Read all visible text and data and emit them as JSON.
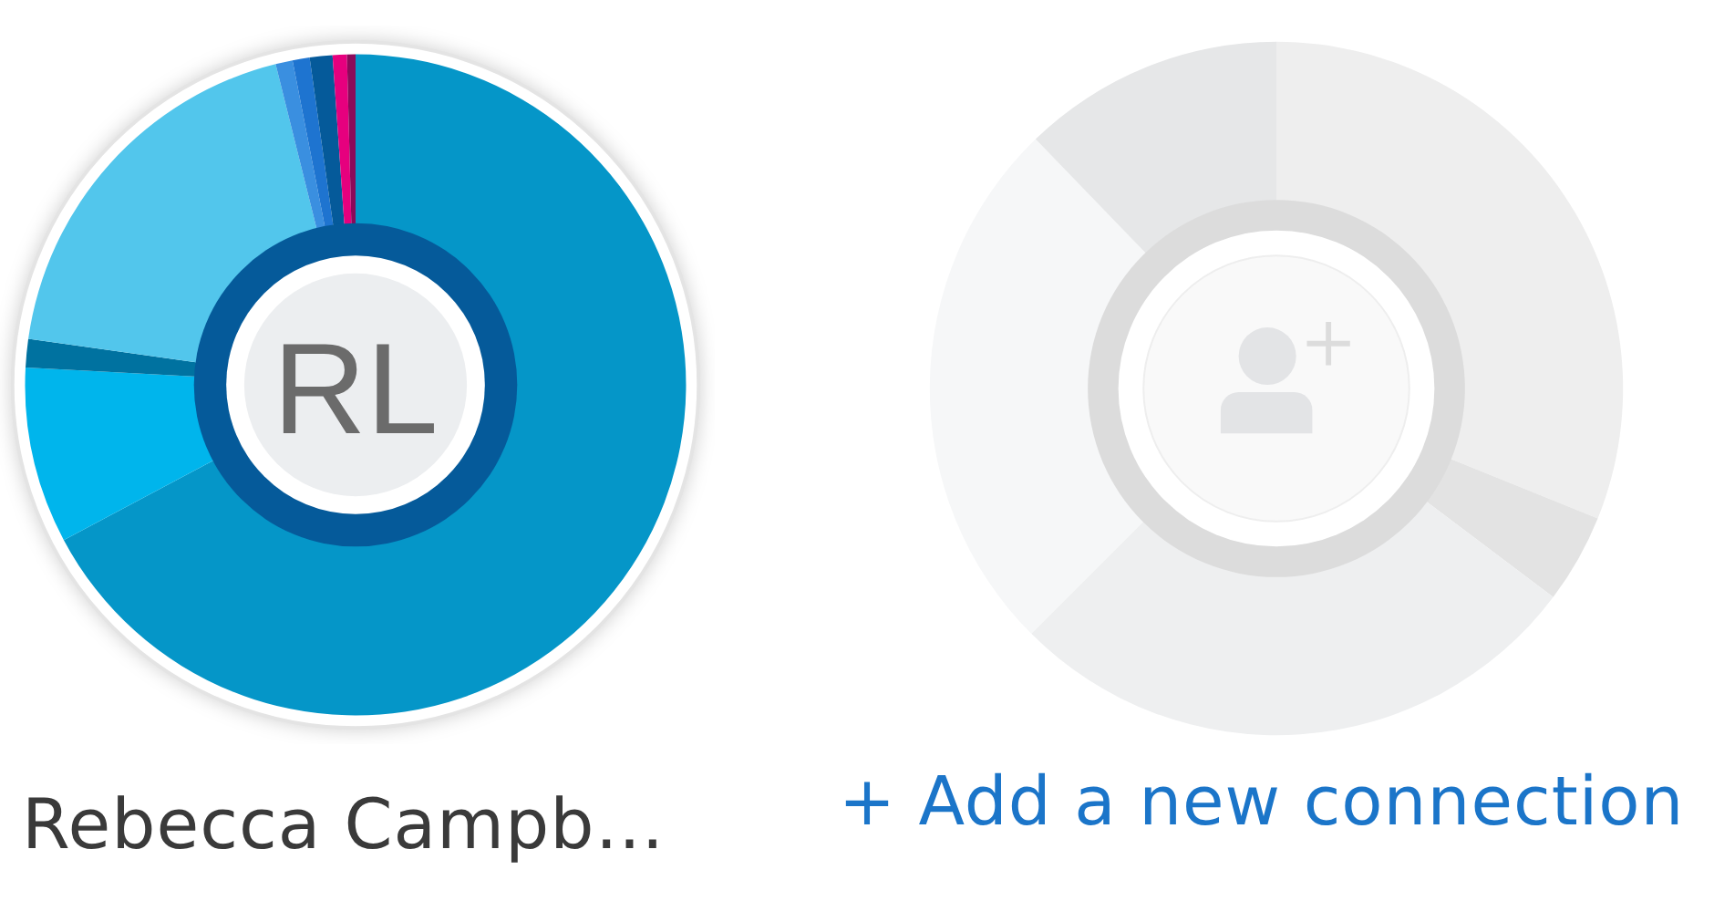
{
  "contacts": [
    {
      "kind": "person",
      "initials": "RL",
      "name": "Rebecca Campb…"
    },
    {
      "kind": "add",
      "link": "+ Add a new connection"
    }
  ]
}
